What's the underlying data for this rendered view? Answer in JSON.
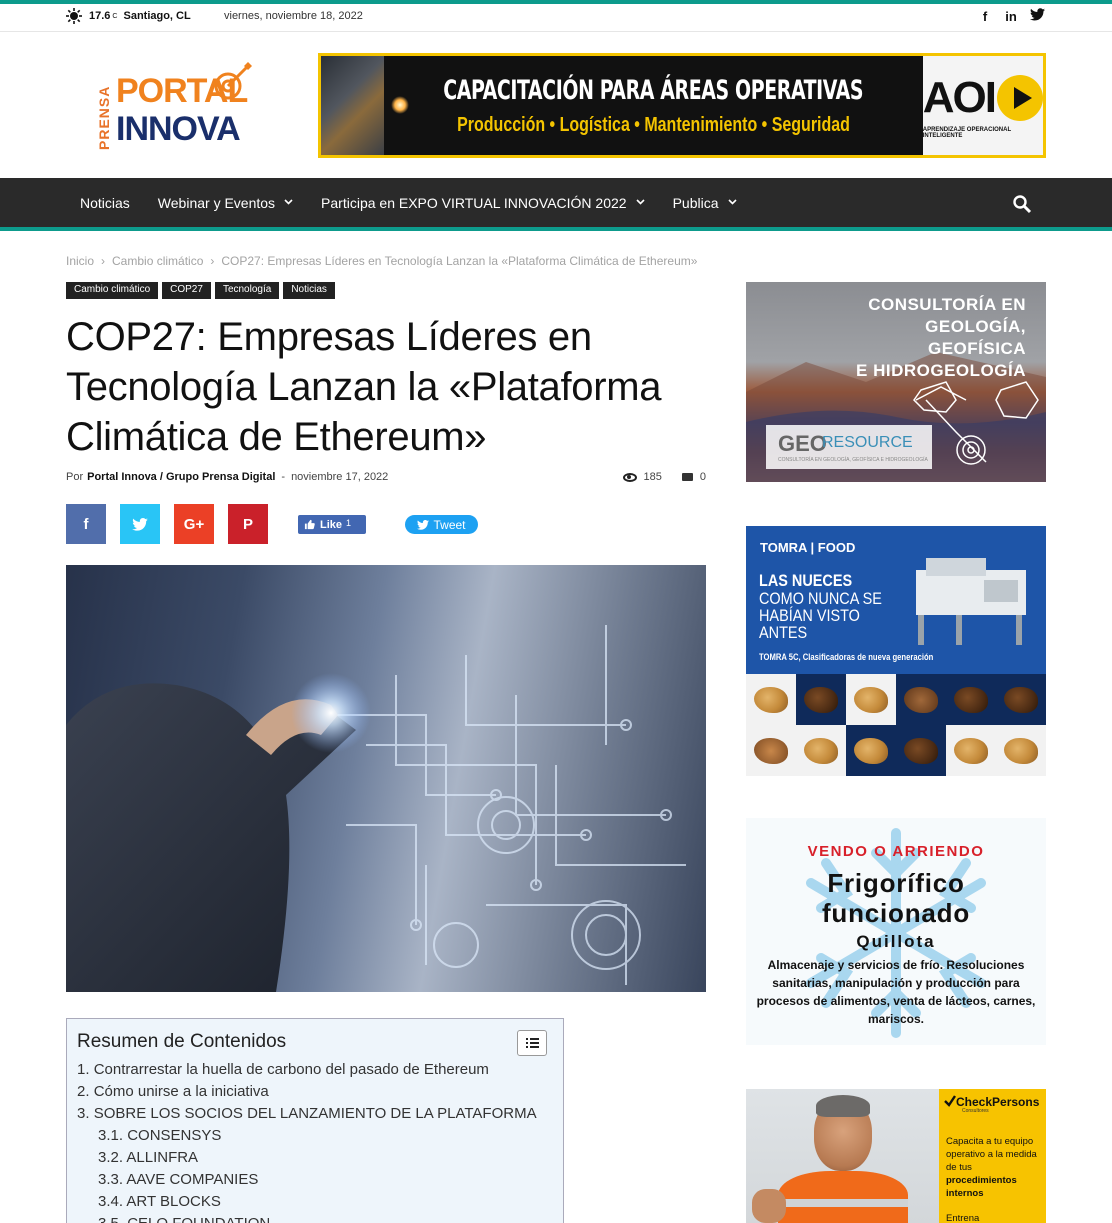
{
  "topbar": {
    "temperature": "17.6",
    "unit": "C",
    "city": "Santiago, CL",
    "date": "viernes, noviembre 18, 2022",
    "social_icons": [
      "facebook-icon",
      "linkedin-icon",
      "twitter-icon"
    ]
  },
  "header": {
    "logo": {
      "prensa": "PRENSA",
      "portal": "PORTAL",
      "innova": "INNOVA"
    },
    "banner": {
      "headline": "CAPACITACIÓN PARA ÁREAS OPERATIVAS",
      "subline": "Producción • Logística • Mantenimiento • Seguridad",
      "brand": "AOI",
      "brand_sub": "APRENDIZAJE OPERACIONAL INTELIGENTE"
    }
  },
  "nav": {
    "items": [
      {
        "label": "Noticias",
        "dropdown": false
      },
      {
        "label": "Webinar y Eventos",
        "dropdown": true
      },
      {
        "label": "Participa en EXPO VIRTUAL INNOVACIÓN 2022",
        "dropdown": true
      },
      {
        "label": "Publica",
        "dropdown": true
      }
    ],
    "accent": "#0d9b8c"
  },
  "breadcrumb": {
    "items": [
      "Inicio",
      "Cambio climático",
      "COP27: Empresas Líderes en Tecnología Lanzan la «Plataforma Climática de Ethereum»"
    ],
    "separator": "›"
  },
  "tags": [
    "Cambio climático",
    "COP27",
    "Tecnología",
    "Noticias"
  ],
  "article": {
    "title": "COP27: Empresas Líderes en Tecnología Lanzan la «Plataforma Climática de Ethereum»",
    "by_label": "Por",
    "author": "Portal Innova / Grupo Prensa Digital",
    "date": "noviembre 17, 2022",
    "views": "185",
    "comments": "0"
  },
  "share": {
    "buttons": [
      {
        "name": "facebook",
        "glyph": "f",
        "color": "#516eab"
      },
      {
        "name": "twitter",
        "glyph": "t",
        "color": "#29c5f6"
      },
      {
        "name": "googleplus",
        "glyph": "G+",
        "color": "#eb4026"
      },
      {
        "name": "pinterest",
        "glyph": "P",
        "color": "#ca212a"
      }
    ],
    "like_label": "Like",
    "like_count": "1",
    "tweet_label": "Tweet"
  },
  "toc": {
    "title": "Resumen de Contenidos",
    "items": [
      {
        "num": "1.",
        "label": "Contrarrestar la huella de carbono del pasado de Ethereum",
        "sub": false
      },
      {
        "num": "2.",
        "label": "Cómo unirse a la iniciativa",
        "sub": false
      },
      {
        "num": "3.",
        "label": "SOBRE LOS SOCIOS DEL LANZAMIENTO DE LA PLATAFORMA",
        "sub": false
      },
      {
        "num": "3.1.",
        "label": "CONSENSYS",
        "sub": true
      },
      {
        "num": "3.2.",
        "label": "ALLINFRA",
        "sub": true
      },
      {
        "num": "3.3.",
        "label": "AAVE COMPANIES",
        "sub": true
      },
      {
        "num": "3.4.",
        "label": "ART BLOCKS",
        "sub": true
      },
      {
        "num": "3.5.",
        "label": "CELO FOUNDATION",
        "sub": true
      }
    ]
  },
  "sidebar": {
    "ad1": {
      "lines": [
        "CONSULTORÍA EN",
        "GEOLOGÍA,",
        "GEOFÍSICA",
        "E HIDROGEOLOGÍA"
      ],
      "brand_a": "GEO",
      "brand_b": "RESOURCE",
      "brand_sub": "CONSULTORÍA EN GEOLOGÍA, GEOFÍSICA E HIDROGEOLOGÍA"
    },
    "ad2": {
      "brand": "TOMRA | FOOD",
      "line1": "LAS NUECES",
      "line2": "COMO NUNCA SE",
      "line3": "HABÍAN VISTO",
      "line4": "ANTES",
      "tagline": "TOMRA 5C, Clasificadoras de nueva generación"
    },
    "ad3": {
      "line1": "VENDO O ARRIENDO",
      "line2": "Frigorífico",
      "line3": "funcionado",
      "line4": "Quillota",
      "body": "Almacenaje y servicios de frío. Resoluciones sanitarias, manipulación y producción para procesos de alimentos, venta de lácteos, carnes, mariscos."
    },
    "ad4": {
      "brand": "CheckPersons",
      "brand_sub": "Consultores",
      "copy_a": "Capacita a tu equipo operativo a la medida de tus",
      "copy_b": "procedimientos internos",
      "more": "Entrena"
    }
  }
}
